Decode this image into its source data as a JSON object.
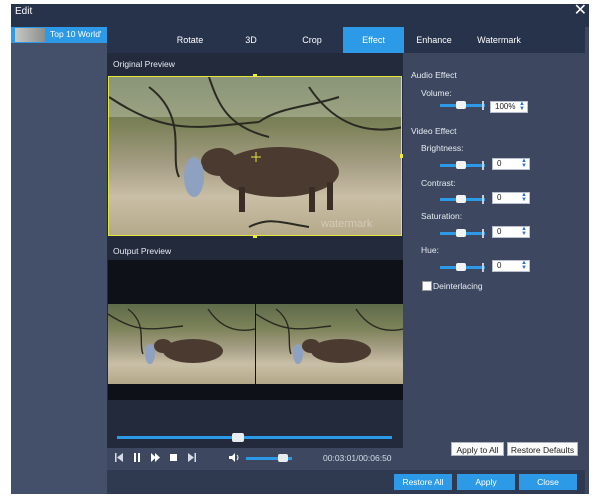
{
  "window": {
    "title": "Edit",
    "close_glyph": "✕"
  },
  "sidebar": {
    "items": [
      {
        "label": "Top 10 World'"
      }
    ]
  },
  "tabs": [
    {
      "label": "Rotate",
      "active": false
    },
    {
      "label": "3D",
      "active": false
    },
    {
      "label": "Crop",
      "active": false
    },
    {
      "label": "Effect",
      "active": true
    },
    {
      "label": "Enhance",
      "active": false
    },
    {
      "label": "Watermark",
      "active": false
    }
  ],
  "preview": {
    "original_label": "Original Preview",
    "output_label": "Output Preview",
    "watermark_text": "watermark"
  },
  "player": {
    "time": "00:03:01/00:06:50",
    "progress": 0.44,
    "volume": 0.8,
    "icons": [
      "skip-back-icon",
      "pause-icon",
      "step-forward-icon",
      "stop-icon",
      "skip-forward-icon",
      "volume-icon"
    ]
  },
  "audio_effect": {
    "section_label": "Audio Effect",
    "volume_label": "Volume:",
    "volume_value": "100%"
  },
  "video_effect": {
    "section_label": "Video Effect",
    "brightness_label": "Brightness:",
    "brightness_value": "0",
    "contrast_label": "Contrast:",
    "contrast_value": "0",
    "saturation_label": "Saturation:",
    "saturation_value": "0",
    "hue_label": "Hue:",
    "hue_value": "0",
    "deinterlacing_label": "Deinterlacing",
    "deinterlacing_checked": false
  },
  "buttons": {
    "apply_to_all": "Apply to All",
    "restore_defaults": "Restore Defaults",
    "restore_all": "Restore All",
    "apply": "Apply",
    "close": "Close"
  },
  "colors": {
    "accent": "#2d9ae8",
    "dialog_bg": "#3d4860",
    "titlebar_bg": "#27324b",
    "crop_frame": "#e6e63a"
  }
}
